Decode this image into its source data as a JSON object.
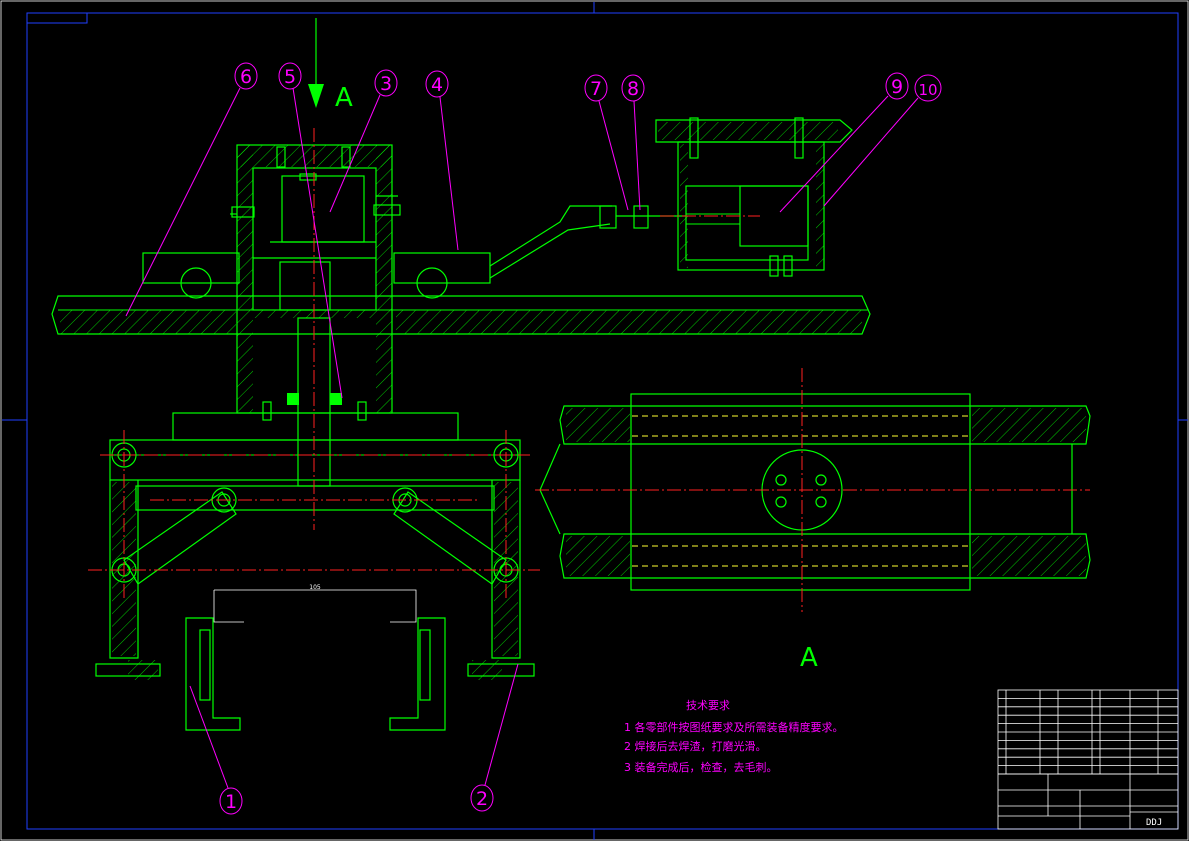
{
  "drawing": {
    "balloons": [
      "6",
      "5",
      "3",
      "4",
      "7",
      "8",
      "9",
      "10",
      "1",
      "2"
    ],
    "view_label_top": "A",
    "view_label_section": "A",
    "dimension_text": "105",
    "notes": {
      "title": "技术要求",
      "items": [
        "1 各零部件按图纸要求及所需装备精度要求。",
        "2 焊接后去焊渣，打磨光滑。",
        "3 装备完成后，检查，去毛刺。"
      ]
    },
    "title_block": {
      "drawing_code": "DDJ"
    },
    "colors": {
      "background": "#000000",
      "outline": "#00ff00",
      "centerline": "#ff2020",
      "hidden": "#ffff33",
      "leader": "#ff00ff",
      "frame": "#2040ff"
    }
  }
}
